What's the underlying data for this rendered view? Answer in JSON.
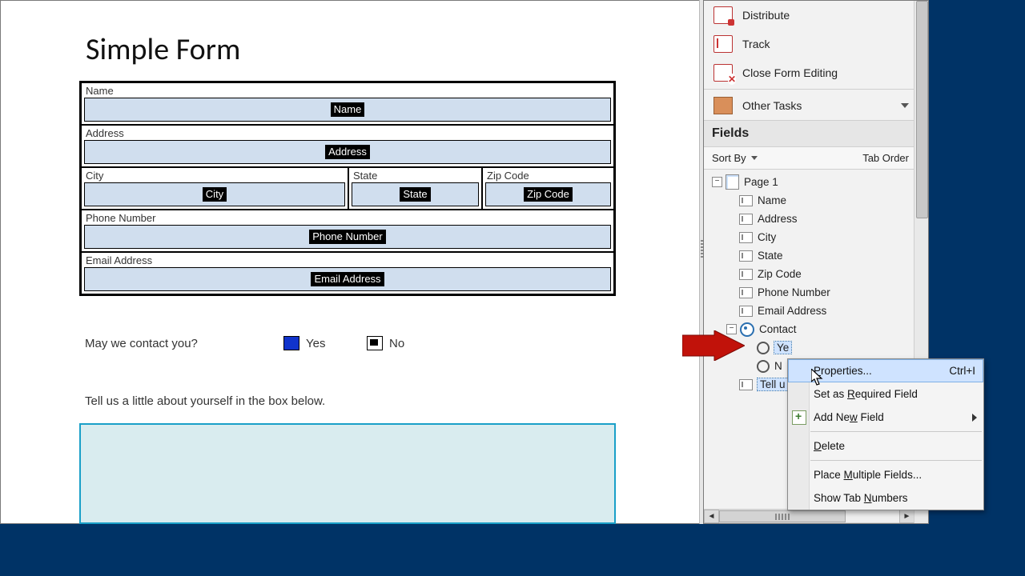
{
  "form": {
    "title": "Simple Form",
    "fields": {
      "name": {
        "label": "Name",
        "chip": "Name"
      },
      "address": {
        "label": "Address",
        "chip": "Address"
      },
      "city": {
        "label": "City",
        "chip": "City"
      },
      "state": {
        "label": "State",
        "chip": "State"
      },
      "zip": {
        "label": "Zip Code",
        "chip": "Zip Code"
      },
      "phone": {
        "label": "Phone Number",
        "chip": "Phone Number"
      },
      "email": {
        "label": "Email Address",
        "chip": "Email Address"
      }
    },
    "contact_question": "May we contact you?",
    "yes": "Yes",
    "no": "No",
    "tell_us": "Tell us a little about yourself in the box below."
  },
  "tasks": {
    "distribute": "Distribute",
    "track": "Track",
    "close": "Close Form Editing",
    "other": "Other Tasks"
  },
  "fields_panel": {
    "header": "Fields",
    "sort_by": "Sort By",
    "tab_order": "Tab Order",
    "page": "Page 1",
    "items": {
      "name": "Name",
      "address": "Address",
      "city": "City",
      "state": "State",
      "zip": "Zip Code",
      "phone": "Phone Number",
      "email": "Email Address",
      "contact": "Contact",
      "yes": "Ye",
      "no": "N",
      "tell": "Tell u"
    }
  },
  "context_menu": {
    "properties": "Properties...",
    "properties_shortcut": "Ctrl+I",
    "required": "Set as Required Field",
    "add_new": "Add New Field",
    "delete": "Delete",
    "place_multi": "Place Multiple Fields...",
    "show_tab": "Show Tab Numbers"
  }
}
